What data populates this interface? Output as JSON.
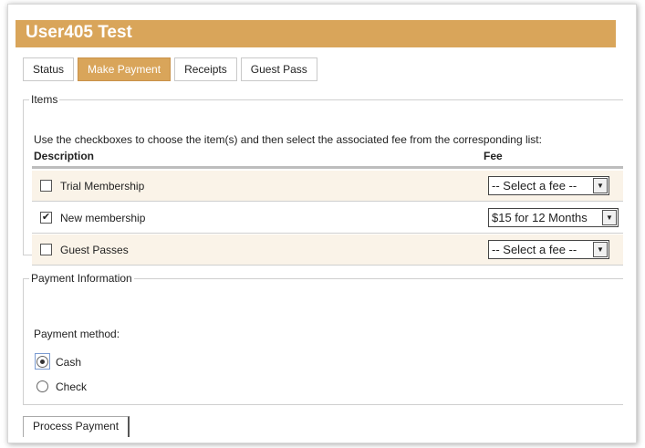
{
  "header": {
    "title": "User405 Test"
  },
  "tabs": [
    {
      "label": "Status",
      "active": false
    },
    {
      "label": "Make Payment",
      "active": true
    },
    {
      "label": "Receipts",
      "active": false
    },
    {
      "label": "Guest Pass",
      "active": false
    }
  ],
  "items": {
    "legend": "Items",
    "instructions": "Use the checkboxes to choose the item(s) and then select the associated fee from the corresponding list:",
    "columns": {
      "description": "Description",
      "fee": "Fee"
    },
    "rows": [
      {
        "label": "Trial Membership",
        "checked": false,
        "fee": "-- Select a fee --"
      },
      {
        "label": "New membership",
        "checked": true,
        "fee": "$15 for 12 Months"
      },
      {
        "label": "Guest Passes",
        "checked": false,
        "fee": "-- Select a fee --"
      }
    ]
  },
  "payment": {
    "legend": "Payment Information",
    "method_label": "Payment method:",
    "options": [
      {
        "label": "Cash",
        "selected": true
      },
      {
        "label": "Check",
        "selected": false
      }
    ]
  },
  "actions": {
    "process_label": "Process Payment"
  },
  "colors": {
    "accent": "#d9a55a",
    "row_alt": "#faf3e8"
  }
}
